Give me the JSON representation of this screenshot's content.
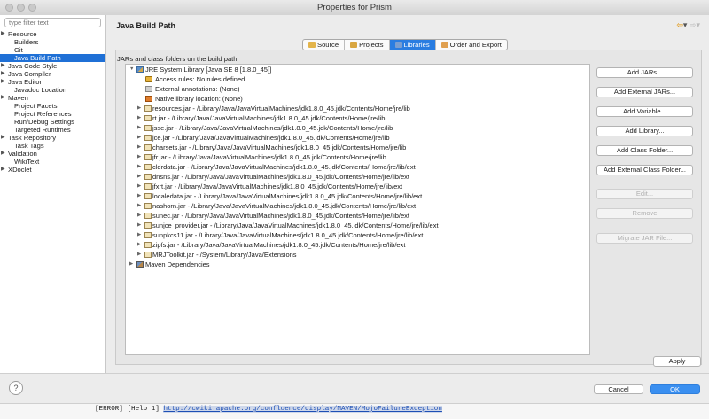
{
  "window": {
    "title": "Properties for Prism"
  },
  "sidebar": {
    "filter_placeholder": "type filter text",
    "items": [
      {
        "label": "Resource",
        "expandable": true
      },
      {
        "label": "Builders",
        "expandable": false
      },
      {
        "label": "Git",
        "expandable": false
      },
      {
        "label": "Java Build Path",
        "expandable": false,
        "selected": true
      },
      {
        "label": "Java Code Style",
        "expandable": true
      },
      {
        "label": "Java Compiler",
        "expandable": true
      },
      {
        "label": "Java Editor",
        "expandable": true
      },
      {
        "label": "Javadoc Location",
        "expandable": false
      },
      {
        "label": "Maven",
        "expandable": true
      },
      {
        "label": "Project Facets",
        "expandable": false
      },
      {
        "label": "Project References",
        "expandable": false
      },
      {
        "label": "Run/Debug Settings",
        "expandable": false
      },
      {
        "label": "Targeted Runtimes",
        "expandable": false
      },
      {
        "label": "Task Repository",
        "expandable": true
      },
      {
        "label": "Task Tags",
        "expandable": false
      },
      {
        "label": "Validation",
        "expandable": true
      },
      {
        "label": "WikiText",
        "expandable": false
      },
      {
        "label": "XDoclet",
        "expandable": true
      }
    ]
  },
  "page": {
    "title": "Java Build Path",
    "tabs": [
      {
        "label": "Source",
        "active": false,
        "icon": "source-folder-icon"
      },
      {
        "label": "Projects",
        "active": false,
        "icon": "projects-icon"
      },
      {
        "label": "Libraries",
        "active": true,
        "icon": "libraries-icon"
      },
      {
        "label": "Order and Export",
        "active": false,
        "icon": "order-export-icon"
      }
    ],
    "list_label": "JARs and class folders on the build path:"
  },
  "entries": [
    {
      "level": 0,
      "twisty": "open",
      "icon": "jre",
      "text": "JRE System Library [Java SE 8 [1.8.0_45]]"
    },
    {
      "level": 1,
      "twisty": "none",
      "icon": "prop",
      "text": "Access rules: No rules defined"
    },
    {
      "level": 1,
      "twisty": "none",
      "icon": "ann",
      "text": "External annotations: (None)"
    },
    {
      "level": 1,
      "twisty": "none",
      "icon": "nat",
      "text": "Native library location: (None)"
    },
    {
      "level": 1,
      "twisty": "closed",
      "icon": "jar",
      "text": "resources.jar - /Library/Java/JavaVirtualMachines/jdk1.8.0_45.jdk/Contents/Home/jre/lib"
    },
    {
      "level": 1,
      "twisty": "closed",
      "icon": "jar",
      "text": "rt.jar - /Library/Java/JavaVirtualMachines/jdk1.8.0_45.jdk/Contents/Home/jre/lib"
    },
    {
      "level": 1,
      "twisty": "closed",
      "icon": "jar",
      "text": "jsse.jar - /Library/Java/JavaVirtualMachines/jdk1.8.0_45.jdk/Contents/Home/jre/lib"
    },
    {
      "level": 1,
      "twisty": "closed",
      "icon": "jar",
      "text": "jce.jar - /Library/Java/JavaVirtualMachines/jdk1.8.0_45.jdk/Contents/Home/jre/lib"
    },
    {
      "level": 1,
      "twisty": "closed",
      "icon": "jar",
      "text": "charsets.jar - /Library/Java/JavaVirtualMachines/jdk1.8.0_45.jdk/Contents/Home/jre/lib"
    },
    {
      "level": 1,
      "twisty": "closed",
      "icon": "jar",
      "text": "jfr.jar - /Library/Java/JavaVirtualMachines/jdk1.8.0_45.jdk/Contents/Home/jre/lib"
    },
    {
      "level": 1,
      "twisty": "closed",
      "icon": "jar",
      "text": "cldrdata.jar - /Library/Java/JavaVirtualMachines/jdk1.8.0_45.jdk/Contents/Home/jre/lib/ext"
    },
    {
      "level": 1,
      "twisty": "closed",
      "icon": "jar",
      "text": "dnsns.jar - /Library/Java/JavaVirtualMachines/jdk1.8.0_45.jdk/Contents/Home/jre/lib/ext"
    },
    {
      "level": 1,
      "twisty": "closed",
      "icon": "jar",
      "text": "jfxrt.jar - /Library/Java/JavaVirtualMachines/jdk1.8.0_45.jdk/Contents/Home/jre/lib/ext"
    },
    {
      "level": 1,
      "twisty": "closed",
      "icon": "jar",
      "text": "localedata.jar - /Library/Java/JavaVirtualMachines/jdk1.8.0_45.jdk/Contents/Home/jre/lib/ext"
    },
    {
      "level": 1,
      "twisty": "closed",
      "icon": "jar",
      "text": "nashorn.jar - /Library/Java/JavaVirtualMachines/jdk1.8.0_45.jdk/Contents/Home/jre/lib/ext"
    },
    {
      "level": 1,
      "twisty": "closed",
      "icon": "jar",
      "text": "sunec.jar - /Library/Java/JavaVirtualMachines/jdk1.8.0_45.jdk/Contents/Home/jre/lib/ext"
    },
    {
      "level": 1,
      "twisty": "closed",
      "icon": "jar",
      "text": "sunjce_provider.jar - /Library/Java/JavaVirtualMachines/jdk1.8.0_45.jdk/Contents/Home/jre/lib/ext"
    },
    {
      "level": 1,
      "twisty": "closed",
      "icon": "jar",
      "text": "sunpkcs11.jar - /Library/Java/JavaVirtualMachines/jdk1.8.0_45.jdk/Contents/Home/jre/lib/ext"
    },
    {
      "level": 1,
      "twisty": "closed",
      "icon": "jar",
      "text": "zipfs.jar - /Library/Java/JavaVirtualMachines/jdk1.8.0_45.jdk/Contents/Home/jre/lib/ext"
    },
    {
      "level": 1,
      "twisty": "closed",
      "icon": "jar",
      "text": "MRJToolkit.jar - /System/Library/Java/Extensions"
    },
    {
      "level": 0,
      "twisty": "closed",
      "icon": "lib",
      "text": "Maven Dependencies"
    }
  ],
  "side_buttons": [
    {
      "label": "Add JARs...",
      "enabled": true
    },
    {
      "label": "Add External JARs...",
      "enabled": true
    },
    {
      "label": "Add Variable...",
      "enabled": true
    },
    {
      "label": "Add Library...",
      "enabled": true
    },
    {
      "label": "Add Class Folder...",
      "enabled": true
    },
    {
      "label": "Add External Class Folder...",
      "enabled": true
    },
    {
      "label": "Edit...",
      "enabled": false
    },
    {
      "label": "Remove",
      "enabled": false
    },
    {
      "label": "Migrate JAR File...",
      "enabled": false
    }
  ],
  "buttons": {
    "apply": "Apply",
    "cancel": "Cancel",
    "ok": "OK",
    "help": "?"
  },
  "nav": {
    "back": "⇦",
    "forward": "⇨",
    "dropdown": "▾"
  },
  "console": {
    "prefix": "[ERROR] [Help 1] ",
    "link": "http://cwiki.apache.org/confluence/display/MAVEN/MojoFailureException"
  },
  "colors": {
    "selection": "#1f70d6",
    "ok_button": "#3a8ff0",
    "nav_arrow": "#e09000"
  }
}
